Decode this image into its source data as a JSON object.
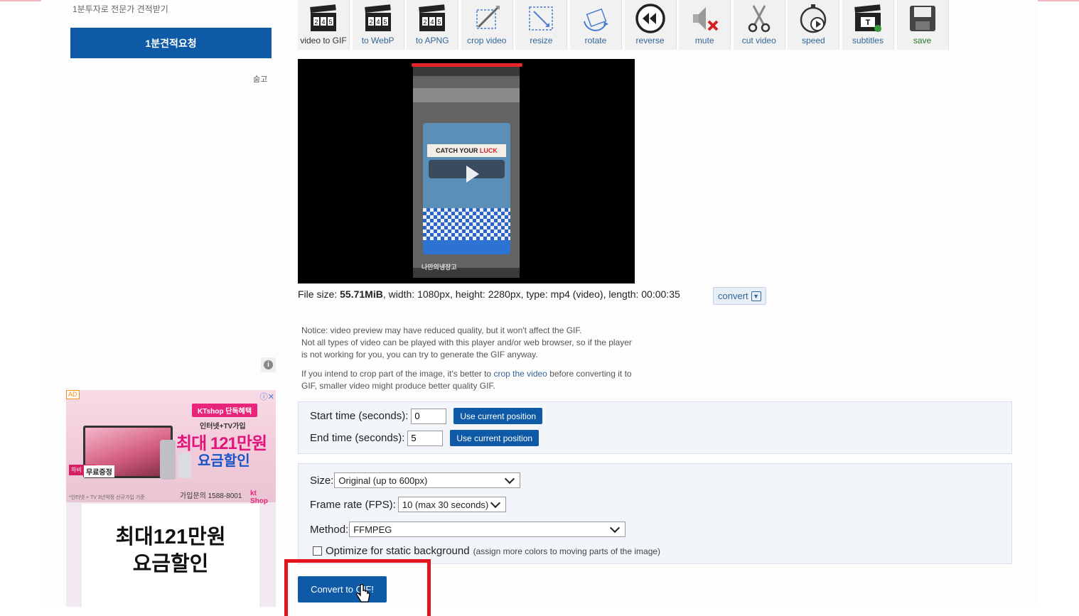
{
  "sidebar": {
    "subtitle": "1분투자로 전문가 견적받기",
    "request_button": "1분견적요청",
    "hide_label": "숨고",
    "info_icon": "i"
  },
  "ad": {
    "badge": "AD",
    "close_symbols": "ⓘ✕",
    "kt_banner": "KTshop 단독혜택",
    "line1": "인터넷+TV가입",
    "line2": "최대 121만원",
    "line3": "요금할인",
    "tag": "하비 가전",
    "free_label": "무료증정",
    "small_print": "*인터넷 + TV 3년약정 신규가입 기준",
    "phone": "가입문의 1588-8001",
    "kt_logo": "kt Shop",
    "card_line1": "최대121만원",
    "card_line2": "요금할인"
  },
  "toolbar": {
    "tools": [
      {
        "label": "video to GIF",
        "icon": "clapperboard-icon"
      },
      {
        "label": "to WebP",
        "icon": "clapperboard-icon"
      },
      {
        "label": "to APNG",
        "icon": "clapperboard-icon"
      },
      {
        "label": "crop video",
        "icon": "crop-icon"
      },
      {
        "label": "resize",
        "icon": "resize-icon"
      },
      {
        "label": "rotate",
        "icon": "rotate-icon"
      },
      {
        "label": "reverse",
        "icon": "rewind-icon"
      },
      {
        "label": "mute",
        "icon": "speaker-mute-icon"
      },
      {
        "label": "cut video",
        "icon": "scissors-icon"
      },
      {
        "label": "speed",
        "icon": "stopwatch-icon"
      },
      {
        "label": "subtitles",
        "icon": "clapperboard-subtitles-icon"
      },
      {
        "label": "save",
        "icon": "floppy-disk-icon"
      }
    ]
  },
  "video": {
    "popup_title_a": "CATCH YOUR ",
    "popup_title_b": "LUCK",
    "bottom_text": "나만의냉장고"
  },
  "fileinfo": {
    "prefix": "File size: ",
    "size": "55.71MiB",
    "rest": ", width: 1080px, height: 2280px, type: mp4 (video), length: 00:00:35",
    "convert_label": "convert"
  },
  "notice": {
    "line1": "Notice: video preview may have reduced quality, but it won't affect the GIF.",
    "line2": "Not all types of video can be played with this player and/or web browser, so if the player",
    "line3": "is not working for you, you can try to generate the GIF anyway.",
    "crop_pre": "If you intend to crop part of the image, it's better to ",
    "crop_link": "crop the video",
    "crop_post": " before converting it to",
    "crop_line2": "GIF, smaller video might produce better quality GIF."
  },
  "form": {
    "start_label": "Start time (seconds):",
    "start_value": "0",
    "end_label": "End time (seconds):",
    "end_value": "5",
    "use_current": "Use current position",
    "size_label": "Size:",
    "size_value": "Original (up to 600px)",
    "fps_label": "Frame rate (FPS):",
    "fps_value": "10 (max 30 seconds)",
    "method_label": "Method:",
    "method_value": "FFMPEG",
    "optimize_label": "Optimize for static background",
    "optimize_note": "(assign more colors to moving parts of the image)",
    "submit": "Convert to GIF!"
  }
}
